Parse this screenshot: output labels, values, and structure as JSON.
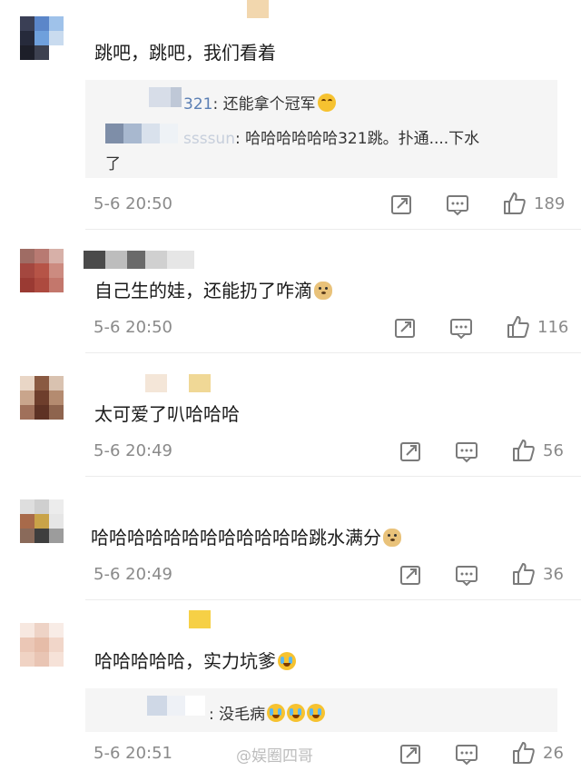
{
  "comments": [
    {
      "text": "跳吧，跳吧，我们看着",
      "replies": [
        {
          "name": "321",
          "text": ": 还能拿个冠军",
          "emoji": "laugh-emoji"
        },
        {
          "name": "ssssun",
          "text": ": 哈哈哈哈哈哈321跳。扑通....下水",
          "continuation": "了"
        }
      ],
      "date": "5-6 20:50",
      "likes": "189"
    },
    {
      "text": "自己生的娃，还能扔了咋滴",
      "emoji": "doge-emoji",
      "date": "5-6 20:50",
      "likes": "116"
    },
    {
      "text": "太可爱了叭哈哈哈",
      "date": "5-6 20:49",
      "likes": "56"
    },
    {
      "text": "哈哈哈哈哈哈哈哈哈哈哈哈跳水满分",
      "emoji": "doge-emoji",
      "date": "5-6 20:49",
      "likes": "36"
    },
    {
      "text": "哈哈哈哈哈，实力坑爹",
      "emoji": "cry-laugh-emoji",
      "replies": [
        {
          "name": "",
          "text": ": 没毛病",
          "emoji": "cry-laugh-emoji x3"
        }
      ],
      "date": "5-6 20:51",
      "likes": "26"
    }
  ],
  "watermark": "@娱圈四哥",
  "colors": {
    "meta_gray": "#8a8a8a",
    "reply_bg": "#f5f5f5",
    "icon_gray": "#7a7a7a"
  }
}
